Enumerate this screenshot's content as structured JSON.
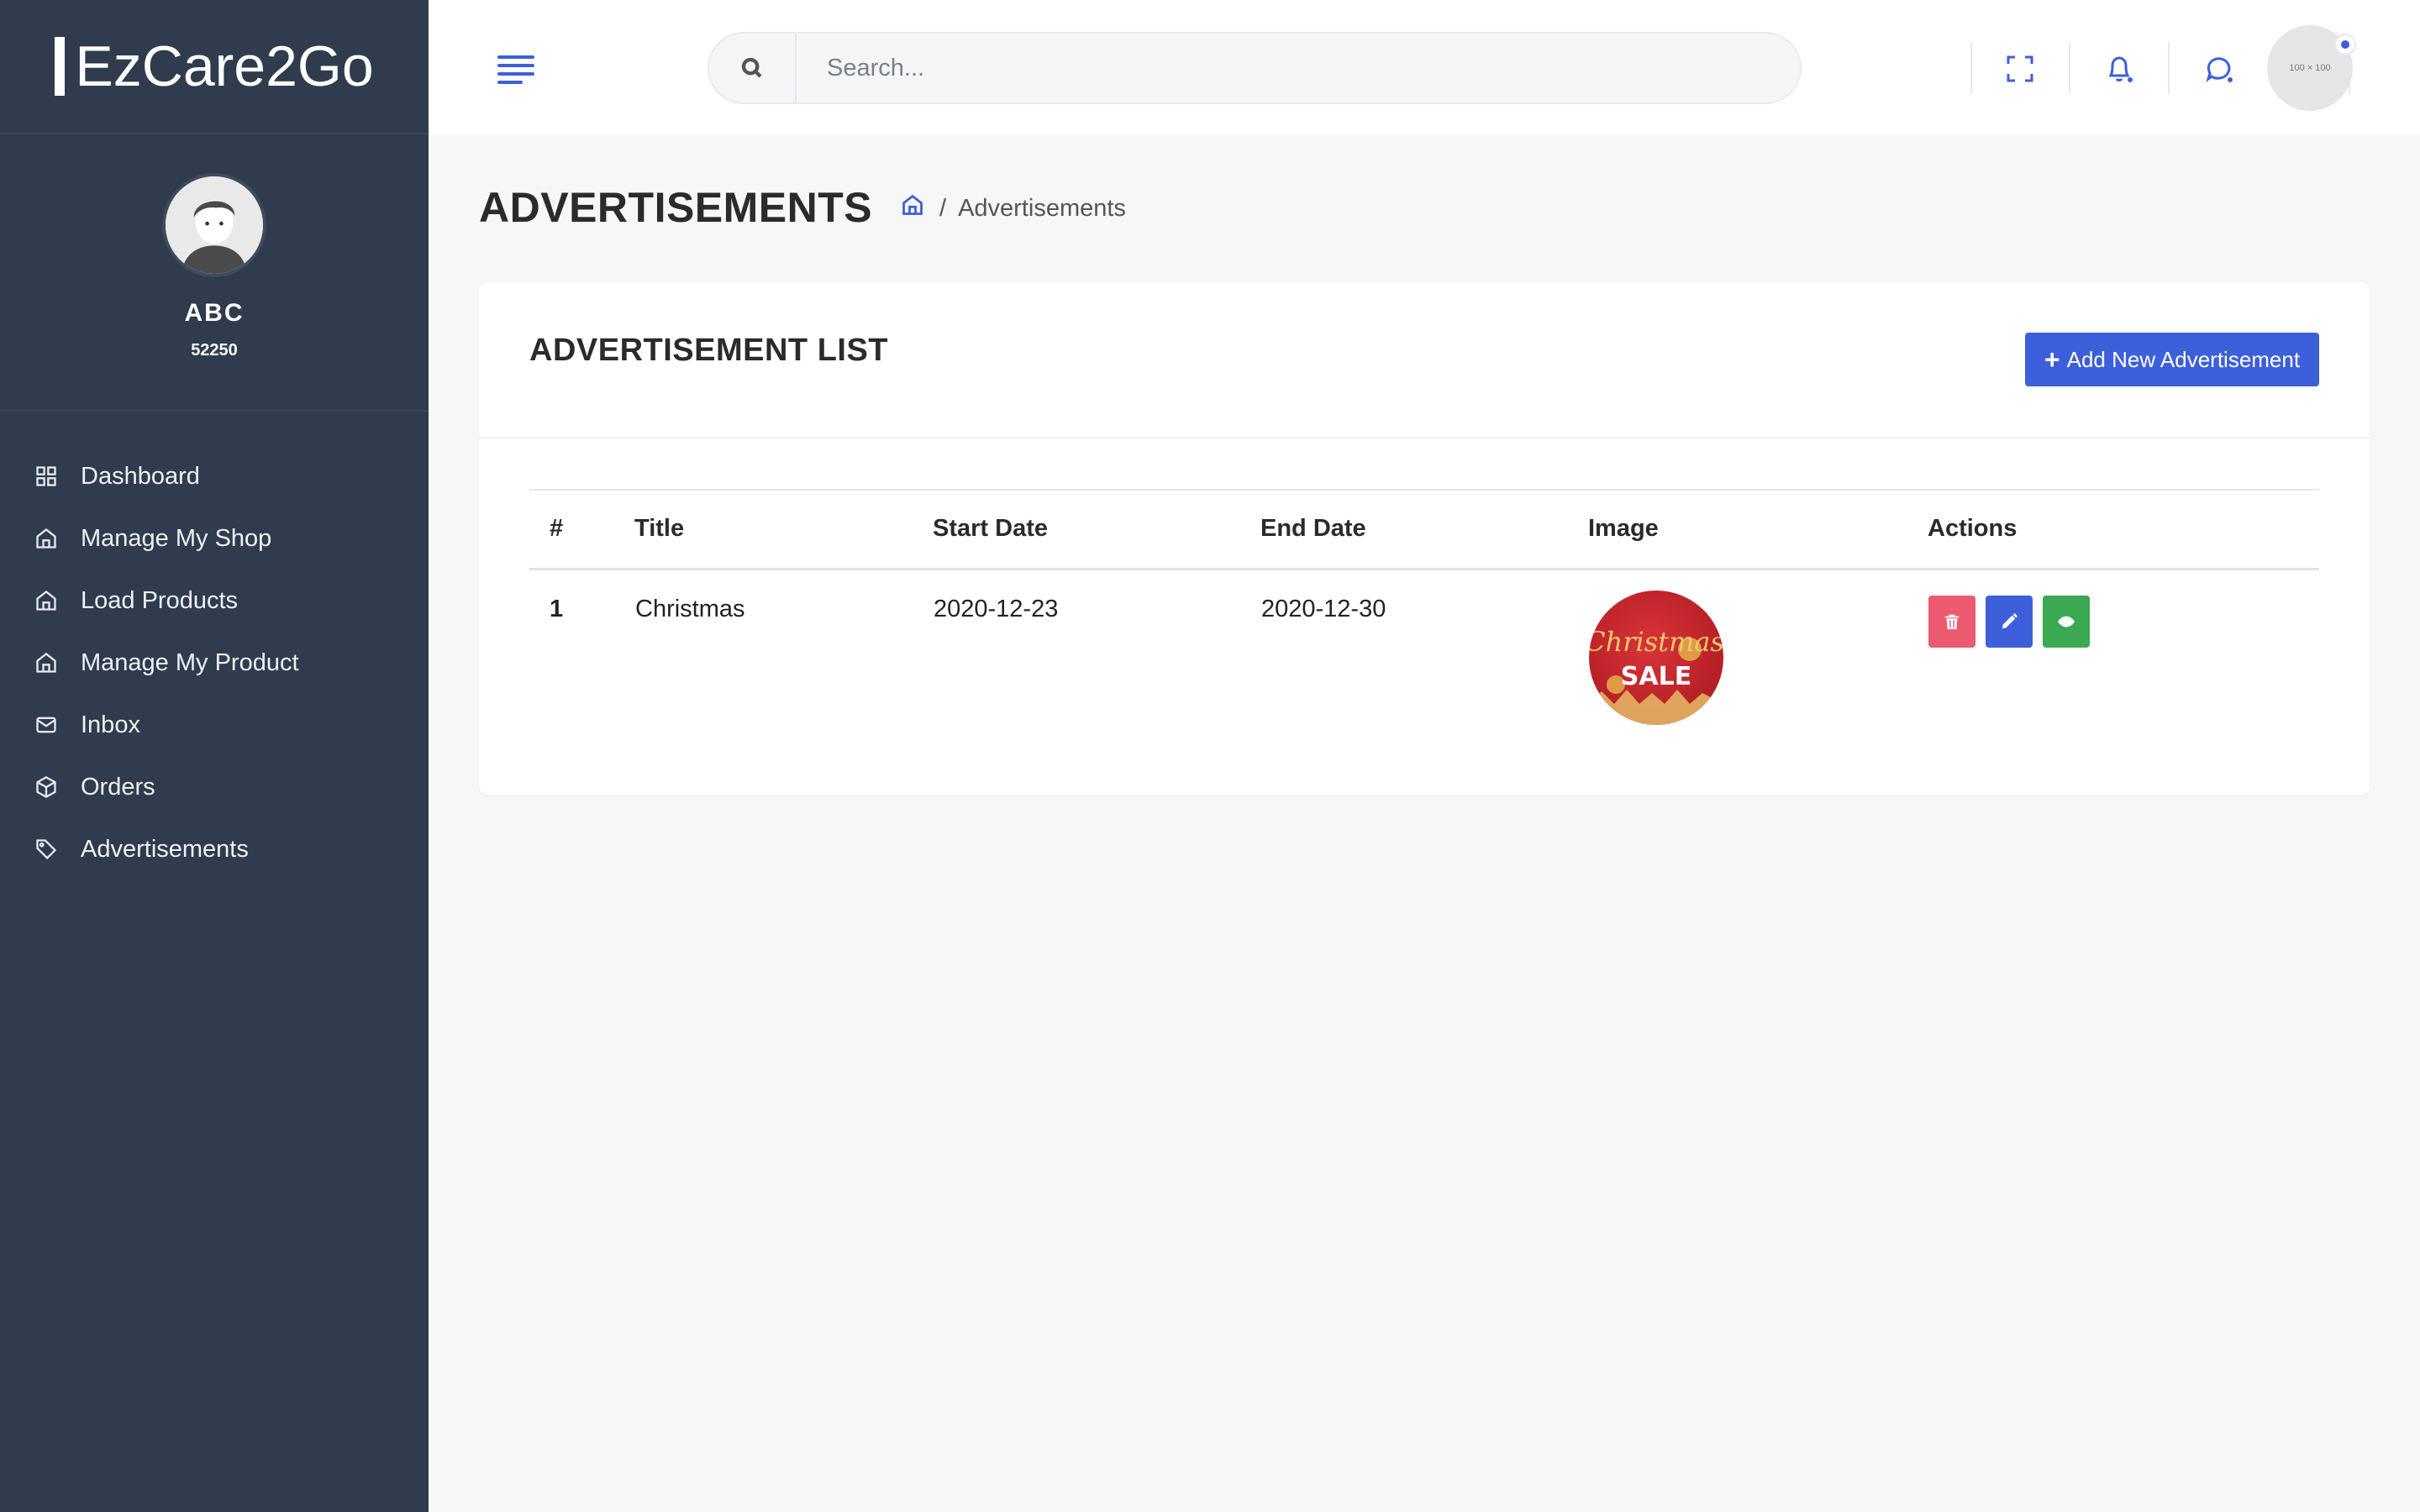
{
  "app": {
    "brand": "EzCare2Go"
  },
  "profile": {
    "name": "ABC",
    "code": "52250"
  },
  "sidebar": {
    "items": [
      {
        "label": "Dashboard",
        "icon": "grid-icon"
      },
      {
        "label": "Manage My Shop",
        "icon": "home-icon"
      },
      {
        "label": "Load Products",
        "icon": "home-icon"
      },
      {
        "label": "Manage My Product",
        "icon": "home-icon"
      },
      {
        "label": "Inbox",
        "icon": "mail-icon"
      },
      {
        "label": "Orders",
        "icon": "box-icon"
      },
      {
        "label": "Advertisements",
        "icon": "tag-icon"
      }
    ]
  },
  "header": {
    "search_placeholder": "Search...",
    "user_avatar_text": "100 × 100"
  },
  "page": {
    "title": "ADVERTISEMENTS",
    "breadcrumb_current": "Advertisements",
    "breadcrumb_separator": "/"
  },
  "card": {
    "title": "ADVERTISEMENT LIST",
    "add_button_label": "Add New Advertisement"
  },
  "table": {
    "columns": [
      "#",
      "Title",
      "Start Date",
      "End Date",
      "Image",
      "Actions"
    ],
    "rows": [
      {
        "num": "1",
        "title": "Christmas",
        "start_date": "2020-12-23",
        "end_date": "2020-12-30",
        "image_text_top": "Christmas",
        "image_text_bottom": "SALE"
      }
    ]
  },
  "colors": {
    "accent": "#3d5fd9",
    "sidebar_bg": "#303b4d",
    "delete": "#ec5a72",
    "view": "#3ba852"
  }
}
